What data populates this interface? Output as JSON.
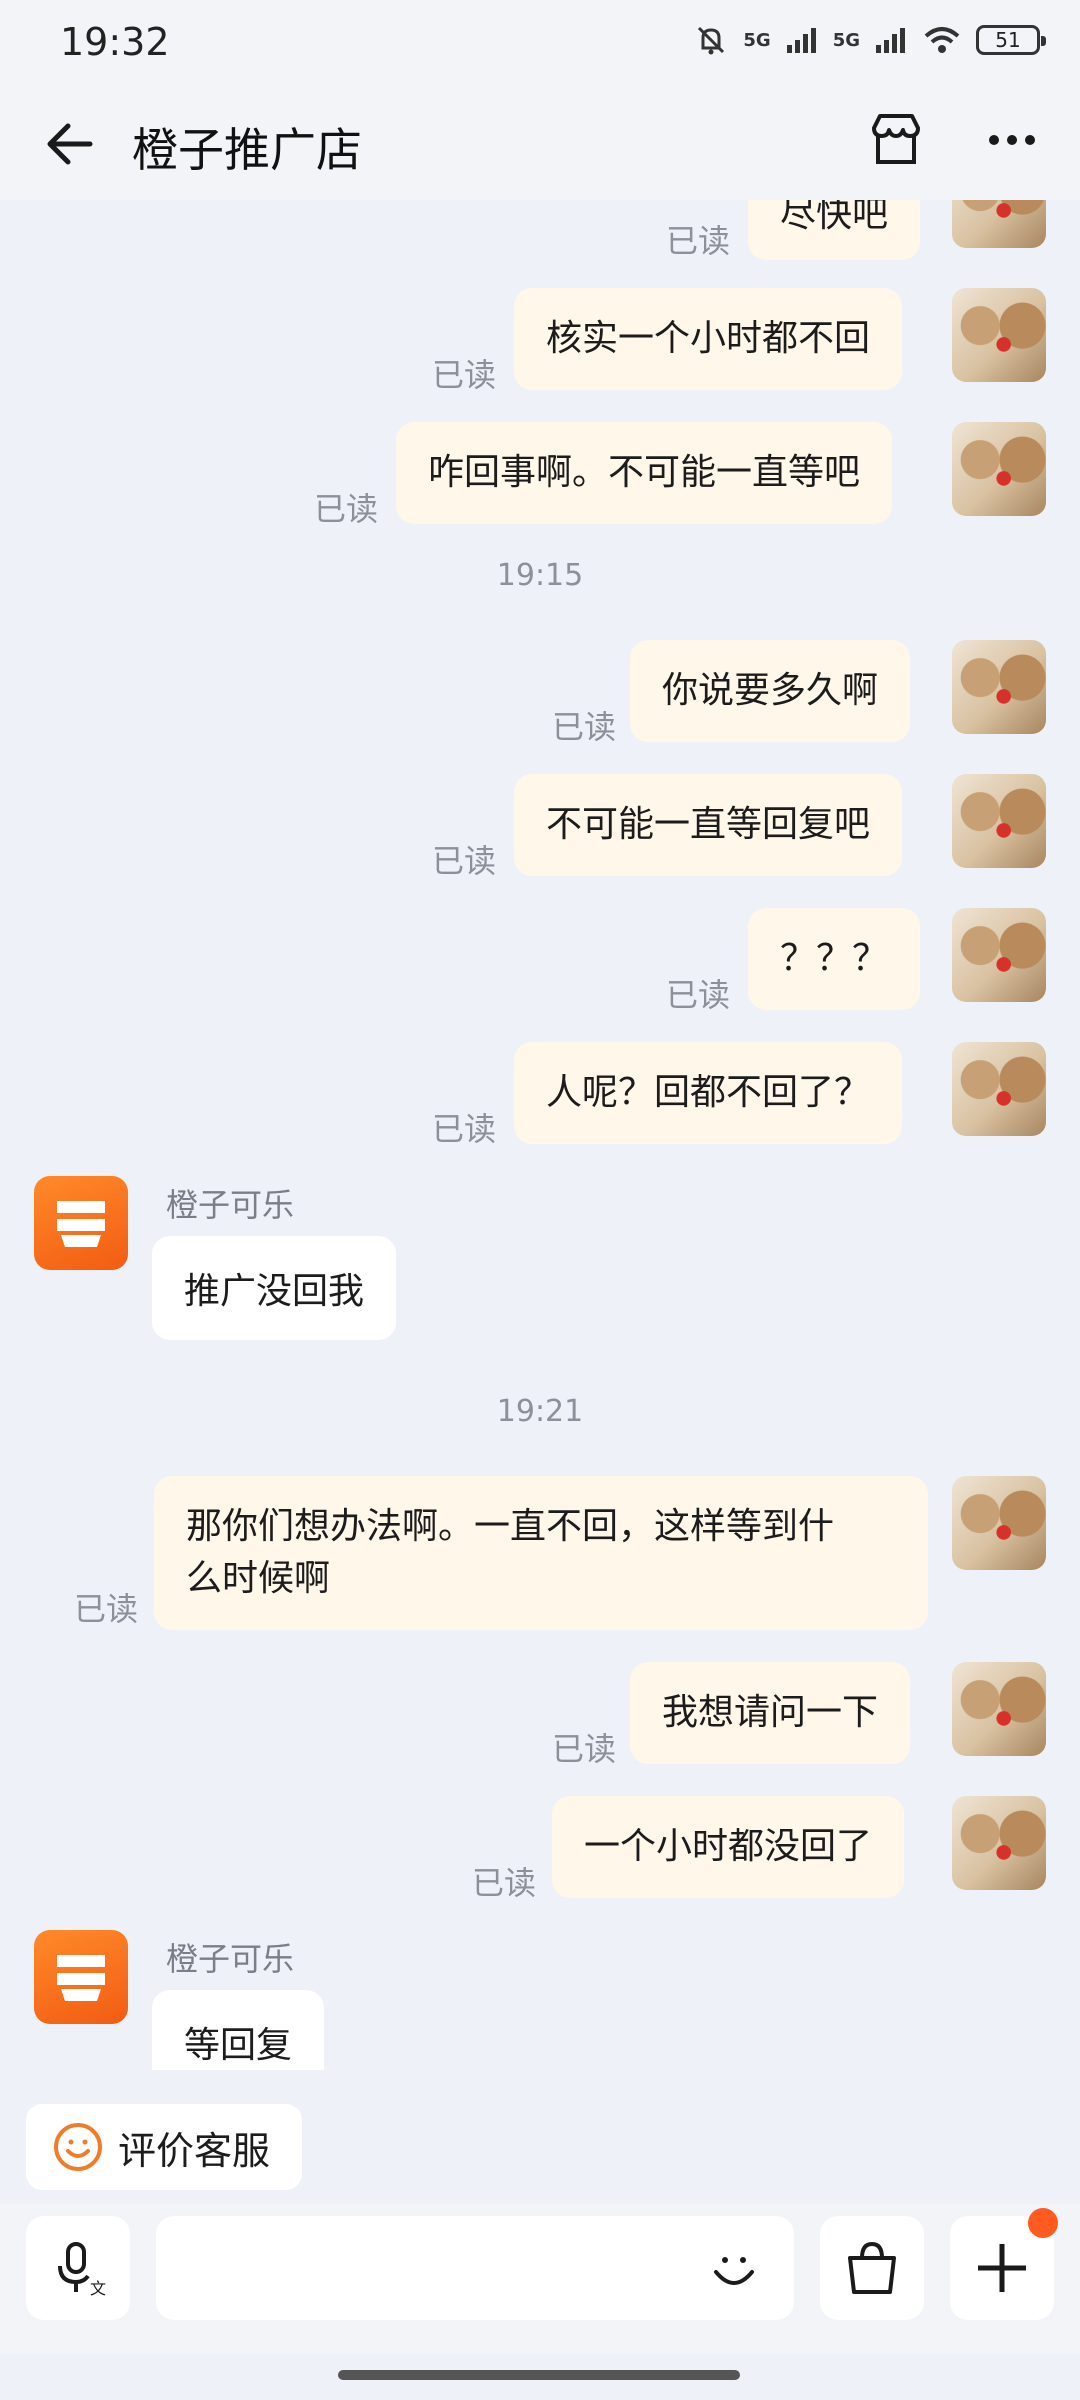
{
  "status_bar": {
    "time": "19:32",
    "signal1": "5G",
    "signal2": "5G",
    "battery": "51"
  },
  "header": {
    "title": "橙子推广店"
  },
  "read_label": "已读",
  "messages_top": [
    {
      "text": "尽快吧"
    },
    {
      "text": "核实一个小时都不回"
    },
    {
      "text": "咋回事啊。不可能一直等吧"
    }
  ],
  "timestamp1": "19:15",
  "messages_mid": [
    {
      "text": "你说要多久啊"
    },
    {
      "text": "不可能一直等回复吧"
    },
    {
      "text": "？？？"
    },
    {
      "text": "人呢？回都不回了？"
    }
  ],
  "shop_reply1": {
    "sender": "橙子可乐",
    "text": "推广没回我"
  },
  "timestamp2": "19:21",
  "messages_late": [
    {
      "line1": "那你们想办法啊。一直不回，这样等到什",
      "line2": "么时候啊"
    },
    {
      "text": "我想请问一下"
    },
    {
      "text": "一个小时都没回了"
    }
  ],
  "shop_reply2": {
    "sender": "橙子可乐",
    "text": "等回复"
  },
  "rate_button": {
    "label": "评价客服"
  },
  "colors": {
    "accent": "#f07c28",
    "bubble_out": "#fff7ea",
    "badge": "#ff5a1f"
  }
}
